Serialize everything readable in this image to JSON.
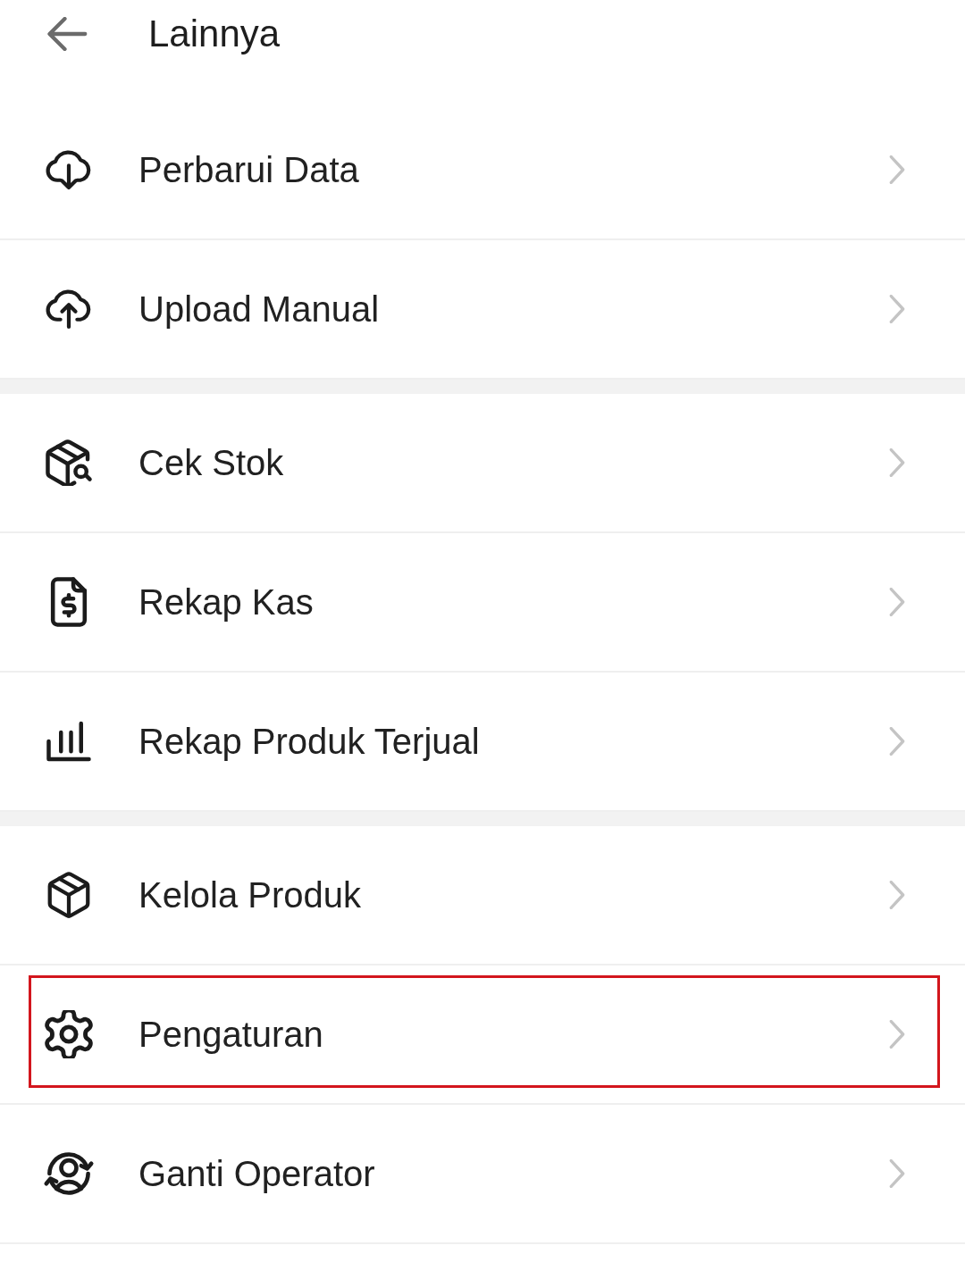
{
  "header": {
    "title": "Lainnya"
  },
  "groups": [
    {
      "items": [
        {
          "label": "Perbarui Data",
          "highlighted": false
        },
        {
          "label": "Upload Manual",
          "highlighted": false
        }
      ]
    },
    {
      "items": [
        {
          "label": "Cek Stok",
          "highlighted": false
        },
        {
          "label": "Rekap Kas",
          "highlighted": false
        },
        {
          "label": "Rekap Produk Terjual",
          "highlighted": false
        }
      ]
    },
    {
      "items": [
        {
          "label": "Kelola Produk",
          "highlighted": false
        },
        {
          "label": "Pengaturan",
          "highlighted": true
        },
        {
          "label": "Ganti Operator",
          "highlighted": false
        }
      ]
    }
  ]
}
